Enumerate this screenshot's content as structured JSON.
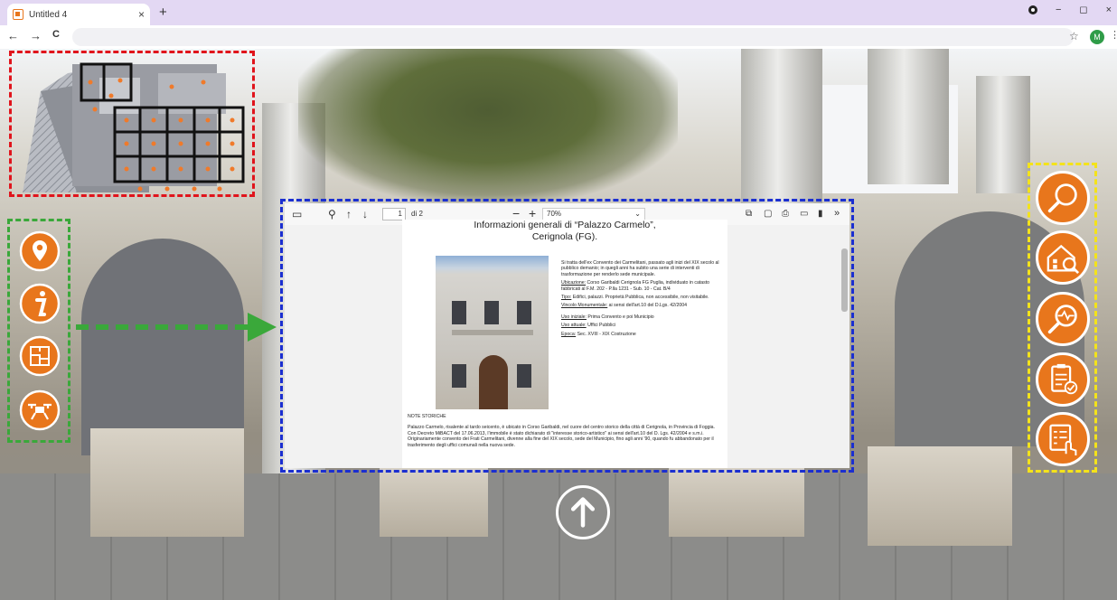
{
  "browser": {
    "tab_title": "Untitled 4",
    "tab_close": "×",
    "new_tab": "+",
    "nav_back": "←",
    "nav_forward": "→",
    "nav_reload": "C",
    "win_min": "−",
    "win_max": "◻",
    "win_close": "×",
    "bookmark": "☆",
    "avatar_letter": "M",
    "menu": "⋮"
  },
  "pdf_viewer": {
    "page_current": "1",
    "page_of": "di 2",
    "zoom_value": "70%",
    "more": "»"
  },
  "document": {
    "title_line1": "Informazioni generali di “Palazzo Carmelo”,",
    "title_line2": "Cerignola (FG).",
    "intro": "Si tratta dell'ex Convento dei Carmelitani, passato agli inizi del XIX secolo al pubblico demanio; in quegli anni ha subito una serie di interventi di trasformazione per renderlo sede municipale.",
    "ubicazione_label": "Ubicazione:",
    "ubicazione_text": " Corso Garibaldi Cerignola FG Puglia, individuato in catasto fabbricati al F.M. 202 - P.lla 1231 - Sub. 10 - Cat. B/4",
    "tipo_label": "Tipo:",
    "tipo_text": " Edifici, palazzi. Proprietà Pubblica, non accessibile, non visitabile.",
    "vincolo_label": "Vincolo Monumentale:",
    "vincolo_text": " ai sensi dell'art.10 del D.Lgs. 42/2004",
    "uso_iniziale_label": "Uso iniziale:",
    "uso_iniziale_text": " Prima Convento e poi Municipio",
    "uso_attuale_label": "Uso attuale:",
    "uso_attuale_text": " Uffici Pubblici",
    "epoca_label": "Epoca:",
    "epoca_text": " Sec. XVIII - XIX Costruzione",
    "notes_heading": "NOTE STORICHE",
    "notes_p1": "Palazzo Carmelo, risalente al tardo seicento, è ubicato in Corso Garibaldi, nel cuore del centro storico della città di Cerignola, in Provincia di Foggia.",
    "notes_p2": "Con Decreto MiBACT del 17.06.2013, l'immobile è stato dichiarato di \"interesse storico-artistico\" ai sensi dell'art.10 del D. Lgs. 42/2004 e s.m.i.",
    "notes_p3": "Originariamente convento dei Frati Carmelitani, divenne alla fine del XIX secolo, sede del Municipio, fino agli anni '90, quando fu abbandonato per il trasferimento degli uffici comunali nella nuova sede."
  },
  "icons": {
    "left": [
      "location-pin-icon",
      "info-icon",
      "floor-plan-icon",
      "drone-icon"
    ],
    "right": [
      "search-icon",
      "building-inspect-icon",
      "diagnostics-icon",
      "checklist-icon",
      "touch-form-icon"
    ],
    "up": "up-arrow-icon"
  },
  "colors": {
    "accent_orange": "#e8761c",
    "frame_red": "#e0141c",
    "frame_green": "#3aa83a",
    "frame_blue": "#1b2fd0",
    "frame_yellow": "#f4e31a"
  }
}
